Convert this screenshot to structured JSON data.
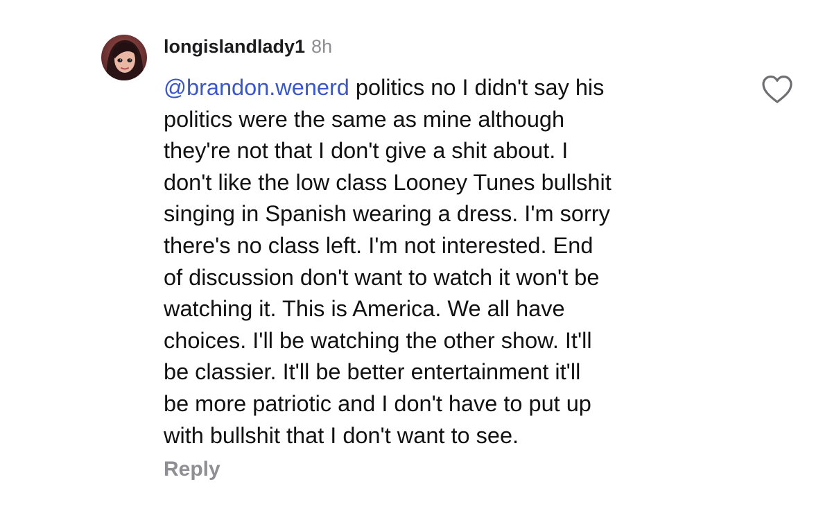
{
  "comment": {
    "username": "longislandlady1",
    "timestamp": "8h",
    "mention": "@brandon.wenerd",
    "first_line_text": " politics no I didn't say his",
    "body_lines": [
      "politics were the same as mine although",
      "they're not that I don't give a shit about. I",
      "don't like the low class Looney Tunes bullshit",
      "singing in Spanish wearing a dress. I'm sorry",
      "there's no class left. I'm not interested. End",
      "of discussion don't want to watch it won't be",
      "watching it. This is America. We all have",
      "choices. I'll be watching the other show. It'll",
      "be classier. It'll be better entertainment it'll",
      "be more patriotic and I don't have to put up",
      "with bullshit that I don't want to see."
    ],
    "reply_label": "Reply",
    "icons": {
      "avatar": "avatar",
      "like": "heart-icon"
    },
    "colors": {
      "mention": "#3857c8",
      "timestamp": "#8e8e93",
      "reply": "#8e8e93",
      "text": "#111111"
    }
  }
}
